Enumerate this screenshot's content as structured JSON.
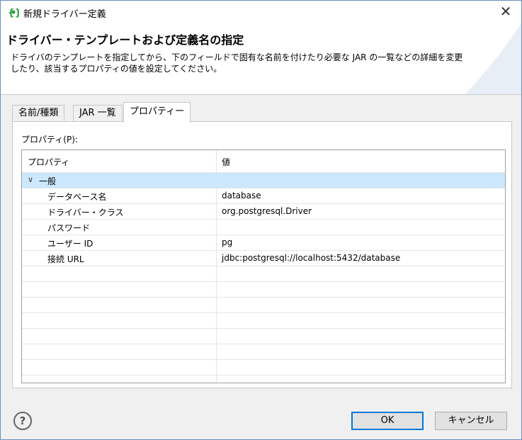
{
  "window": {
    "title": "新規ドライバー定義",
    "close": "✕"
  },
  "header": {
    "title": "ドライバー・テンプレートおよび定義名の指定",
    "description": "ドライバのテンプレートを指定してから、下のフィールドで固有な名前を付けたり必要な JAR の一覧などの詳細を変更したり、該当するプロパティの値を設定してください。"
  },
  "tabs": [
    {
      "label": "名前/種類"
    },
    {
      "label": "JAR 一覧"
    },
    {
      "label": "プロパティー",
      "active": true
    }
  ],
  "properties": {
    "label": "プロパティ(P):",
    "columns": {
      "name": "プロパティ",
      "value": "値"
    },
    "group": {
      "label": "一般",
      "expanded": true
    },
    "rows": [
      {
        "name": "データベース名",
        "value": "database"
      },
      {
        "name": "ドライバー・クラス",
        "value": "org.postgresql.Driver"
      },
      {
        "name": "パスワード",
        "value": ""
      },
      {
        "name": "ユーザー ID",
        "value": "pg"
      },
      {
        "name": "接続 URL",
        "value": "jdbc:postgresql://localhost:5432/database"
      }
    ]
  },
  "footer": {
    "help": "?",
    "ok": "OK",
    "cancel": "キャンセル"
  },
  "colors": {
    "accent": "#0078d7",
    "selection": "#cce8ff",
    "icon": "#2e9b3b"
  }
}
